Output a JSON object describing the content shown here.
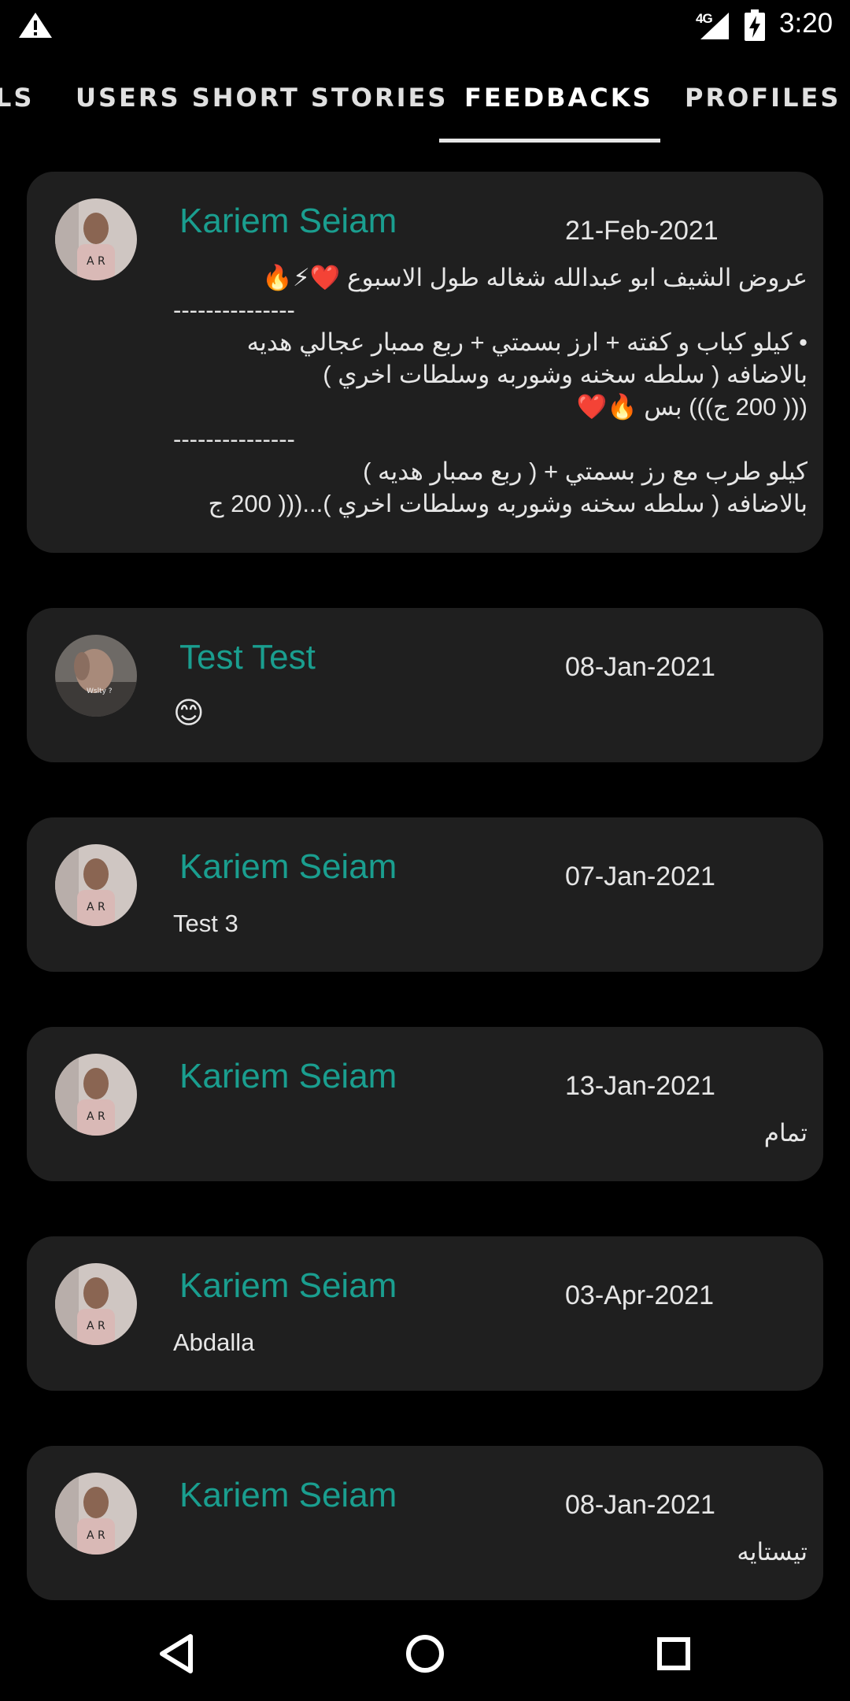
{
  "status_bar": {
    "time": "3:20",
    "network": "4G",
    "icons": [
      "warning-icon",
      "signal-icon",
      "battery-charging-icon"
    ]
  },
  "tabs": {
    "items": [
      {
        "label": "LS",
        "selected": false
      },
      {
        "label": "USERS SHORT STORIES",
        "selected": false
      },
      {
        "label": "FEEDBACKS",
        "selected": true
      },
      {
        "label": "PROFILES",
        "selected": false
      }
    ]
  },
  "feedbacks": [
    {
      "name": "Kariem Seiam",
      "date": "21-Feb-2021",
      "message_lines": [
        "عروض الشيف ابو عبدالله شغاله طول الاسبوع ❤️⚡🔥",
        "---------------",
        "• كيلو كباب و كفته + ارز بسمتي + ربع ممبار عجالي هديه",
        "بالاضافه ( سلطه سخنه وشوربه وسلطات اخري )",
        "((( 200 ج))) بس 🔥❤️",
        "---------------",
        "كيلو طرب مع رز بسمتي + ( ربع ممبار هديه )",
        "بالاضافه ( سلطه سخنه وشوربه وسلطات اخري )...((( 200 ج"
      ]
    },
    {
      "name": "Test Test",
      "date": "08-Jan-2021",
      "message_lines": [
        "😊"
      ]
    },
    {
      "name": "Kariem Seiam",
      "date": "07-Jan-2021",
      "message_lines": [
        "Test 3"
      ]
    },
    {
      "name": "Kariem Seiam",
      "date": "13-Jan-2021",
      "message_lines": [
        "تمام"
      ]
    },
    {
      "name": "Kariem Seiam",
      "date": "03-Apr-2021",
      "message_lines": [
        "Abdalla"
      ]
    },
    {
      "name": "Kariem Seiam",
      "date": "08-Jan-2021",
      "message_lines": [
        "تيستايه"
      ]
    }
  ],
  "nav_bar": {
    "icons": [
      "back-icon",
      "home-icon",
      "recents-icon"
    ]
  },
  "colors": {
    "background": "#000000",
    "card": "#1f1f1f",
    "accent_name": "#1a9e8f",
    "text": "#e6e6e6"
  }
}
